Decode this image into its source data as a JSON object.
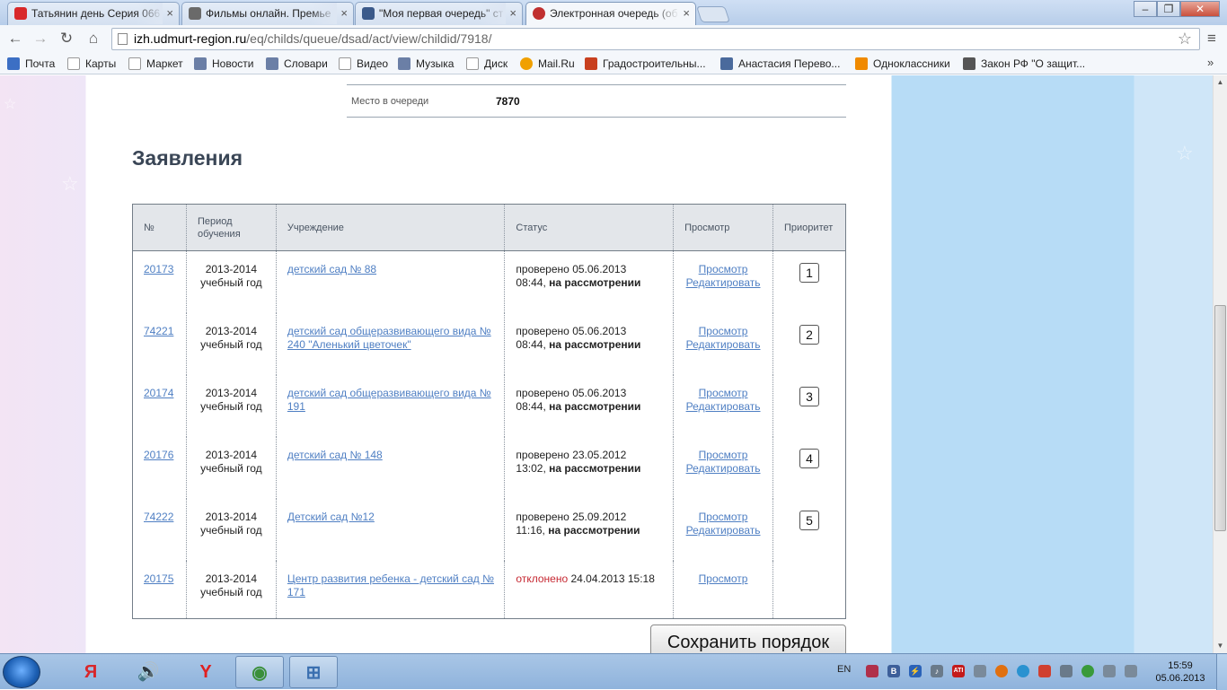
{
  "browser": {
    "tabs": [
      {
        "title": "Татьянин день Серия 066",
        "icon": "youtube-icon",
        "color": "#d8282a"
      },
      {
        "title": "Фильмы онлайн. Премье",
        "icon": "film-icon",
        "color": "#6a6a6a"
      },
      {
        "title": "\"Моя первая очередь\" ст",
        "icon": "mail-icon",
        "color": "#3b5a8a"
      },
      {
        "title": "Электронная очередь (об",
        "icon": "crest-icon",
        "color": "#c03030"
      }
    ],
    "window_controls": {
      "minimize": "–",
      "maximize": "❐",
      "close": "✕"
    },
    "url": {
      "host": "izh.udmurt-region.ru",
      "path": "/eq/childs/queue/dsad/act/view/childid/7918/"
    },
    "bookmarks": [
      {
        "label": "Почта",
        "icon": "mail-icon",
        "color": "#3c6fc4"
      },
      {
        "label": "Карты",
        "icon": "page-icon"
      },
      {
        "label": "Маркет",
        "icon": "page-icon"
      },
      {
        "label": "Новости",
        "icon": "news-icon",
        "color": "#6b7fa6"
      },
      {
        "label": "Словари",
        "icon": "dictionary-icon",
        "color": "#6b7fa6"
      },
      {
        "label": "Видео",
        "icon": "page-icon"
      },
      {
        "label": "Музыка",
        "icon": "music-icon",
        "color": "#6b7fa6"
      },
      {
        "label": "Диск",
        "icon": "page-icon"
      },
      {
        "label": "Mail.Ru",
        "icon": "mailru-icon",
        "color": "#f0a000"
      },
      {
        "label": "Градостроительны...",
        "icon": "emblem-icon",
        "color": "#c8401f"
      },
      {
        "label": "Анастасия Перево...",
        "icon": "vk-icon",
        "color": "#4a6a9c"
      },
      {
        "label": "Одноклассники",
        "icon": "ok-icon",
        "color": "#f08a00"
      },
      {
        "label": "Закон РФ \"О защит...",
        "icon": "portrait-icon",
        "color": "#555555"
      }
    ],
    "more": "»"
  },
  "page": {
    "place_label": "Место в очереди",
    "place_value": "7870",
    "heading": "Заявления",
    "columns": {
      "num": "№",
      "period": "Период обучения",
      "institution": "Учреждение",
      "status": "Статус",
      "view": "Просмотр",
      "priority": "Приоритет"
    },
    "rows": [
      {
        "num": "20173",
        "period_years": "2013-2014",
        "period_type": "учебный год",
        "institution": "детский сад № 88",
        "status_prefix": "проверено",
        "status_date": "05.06.2013",
        "status_time": "08:44,",
        "status_state": "на рассмотрении",
        "view": "Просмотр",
        "edit": "Редактировать",
        "priority": "1"
      },
      {
        "num": "74221",
        "period_years": "2013-2014",
        "period_type": "учебный год",
        "institution": "детский сад общеразвивающего вида № 240 \"Аленький цветочек\"",
        "status_prefix": "проверено",
        "status_date": "05.06.2013",
        "status_time": "08:44,",
        "status_state": "на рассмотрении",
        "view": "Просмотр",
        "edit": "Редактировать",
        "priority": "2"
      },
      {
        "num": "20174",
        "period_years": "2013-2014",
        "period_type": "учебный год",
        "institution": "детский сад общеразвивающего вида № 191",
        "status_prefix": "проверено",
        "status_date": "05.06.2013",
        "status_time": "08:44,",
        "status_state": "на рассмотрении",
        "view": "Просмотр",
        "edit": "Редактировать",
        "priority": "3"
      },
      {
        "num": "20176",
        "period_years": "2013-2014",
        "period_type": "учебный год",
        "institution": "детский сад № 148",
        "status_prefix": "проверено",
        "status_date": "23.05.2012",
        "status_time": "13:02,",
        "status_state": "на рассмотрении",
        "view": "Просмотр",
        "edit": "Редактировать",
        "priority": "4"
      },
      {
        "num": "74222",
        "period_years": "2013-2014",
        "period_type": "учебный год",
        "institution": "Детский сад №12",
        "status_prefix": "проверено",
        "status_date": "25.09.2012",
        "status_time": "11:16,",
        "status_state": "на рассмотрении",
        "view": "Просмотр",
        "edit": "Редактировать",
        "priority": "5"
      }
    ],
    "rejected_row": {
      "num": "20175",
      "period_years": "2013-2014",
      "period_type": "учебный год",
      "institution": "Центр развития ребенка - детский сад № 171",
      "status_state": "отклонено",
      "status_datetime": "24.04.2013 15:18",
      "view": "Просмотр"
    },
    "save_button": "Сохранить порядок"
  },
  "taskbar": {
    "apps": [
      {
        "name": "yandex-browser",
        "glyph": "Я",
        "color": "#d8262a"
      },
      {
        "name": "volume-mixer",
        "glyph": "🔊",
        "color": "#2a6ab3"
      },
      {
        "name": "yandex",
        "glyph": "Y",
        "color": "#e02020"
      },
      {
        "name": "chrome",
        "glyph": "◉",
        "color": "#3a8f3a"
      },
      {
        "name": "system-app",
        "glyph": "⊞",
        "color": "#3a6fb0"
      }
    ],
    "lang": "EN",
    "time": "15:59",
    "date": "05.06.2013"
  },
  "colors": {
    "link": "#4f7fc3",
    "rejected": "#c62832",
    "heading": "#3a4656",
    "table_header_bg": "#e3e6ea"
  }
}
